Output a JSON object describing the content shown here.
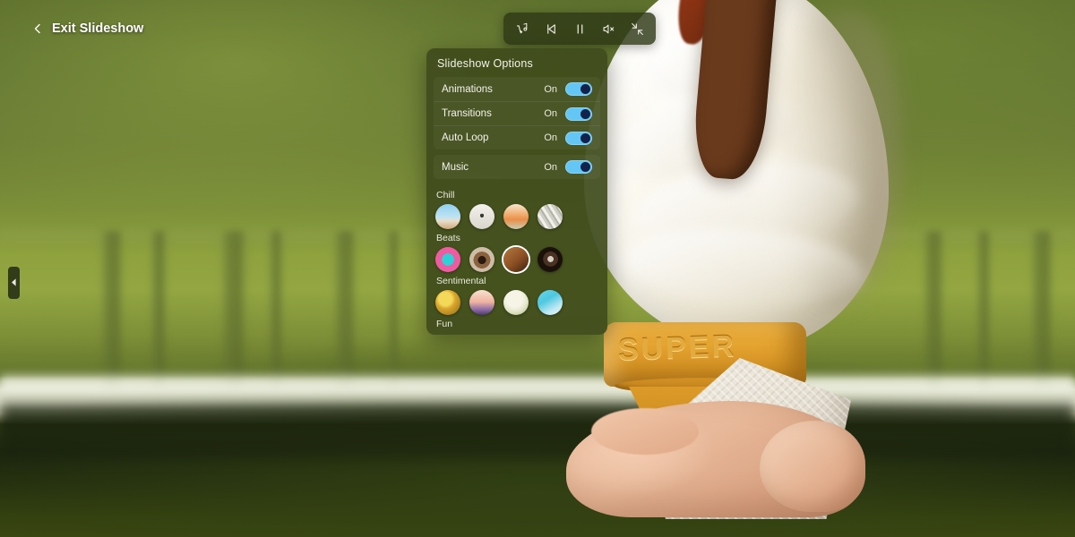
{
  "topbar": {
    "exit_label": "Exit Slideshow",
    "back_icon": "chevron-left-icon"
  },
  "media_toolbar": {
    "buttons": [
      {
        "name": "shuffle-music-button",
        "icon": "shuffle-music-note-icon",
        "title": "Shuffle music"
      },
      {
        "name": "previous-button",
        "icon": "skip-previous-icon",
        "title": "Previous"
      },
      {
        "name": "pause-button",
        "icon": "pause-icon",
        "title": "Pause"
      },
      {
        "name": "mute-button",
        "icon": "speaker-mute-icon",
        "title": "Mute"
      },
      {
        "name": "exit-fullscreen-button",
        "icon": "collapse-arrows-icon",
        "title": "Exit full screen"
      }
    ]
  },
  "left_handle": {
    "icon": "caret-left-icon"
  },
  "panel": {
    "title": "Slideshow Options",
    "toggles": [
      {
        "label": "Animations",
        "state": "On",
        "on": true
      },
      {
        "label": "Transitions",
        "state": "On",
        "on": true
      },
      {
        "label": "Auto Loop",
        "state": "On",
        "on": true
      }
    ],
    "music_toggle": {
      "label": "Music",
      "state": "On",
      "on": true
    },
    "music_categories": [
      {
        "name": "Chill",
        "tracks": [
          {
            "id": "chill-1",
            "selected": false,
            "colors": [
              "#8fd0ef",
              "#bfe3f2",
              "#e8dfcc",
              "#cfa97e"
            ]
          },
          {
            "id": "chill-2",
            "selected": false,
            "colors": [
              "#f4f2ee",
              "#e4e1da",
              "#3a3a34",
              "#d8d5cd"
            ]
          },
          {
            "id": "chill-3",
            "selected": false,
            "colors": [
              "#f7e6cf",
              "#f0a766",
              "#e98f4a",
              "#c9ccb4"
            ]
          },
          {
            "id": "chill-4",
            "selected": false,
            "colors": [
              "#f2f1ec",
              "#d9d8d0",
              "#b3b2a8",
              "#e7e6df"
            ]
          }
        ]
      },
      {
        "name": "Beats",
        "tracks": [
          {
            "id": "beats-1",
            "selected": false,
            "colors": [
              "#f06fae",
              "#ef5ba0",
              "#2ed2d6",
              "#35c9cf"
            ]
          },
          {
            "id": "beats-2",
            "selected": false,
            "colors": [
              "#cdbca6",
              "#6e4a2e",
              "#2b1a10",
              "#8a6240"
            ]
          },
          {
            "id": "beats-3",
            "selected": true,
            "colors": [
              "#b9793f",
              "#8a4f23",
              "#3a2111",
              "#9c6332"
            ]
          },
          {
            "id": "beats-4",
            "selected": false,
            "colors": [
              "#d8cfc2",
              "#4a3222",
              "#1a110a",
              "#6b4a30"
            ]
          }
        ]
      },
      {
        "name": "Sentimental",
        "tracks": [
          {
            "id": "sent-1",
            "selected": false,
            "colors": [
              "#f3d85a",
              "#d9a52c",
              "#8c6a1a",
              "#e8c champion"
            ]
          },
          {
            "id": "sent-2",
            "selected": false,
            "colors": [
              "#f7e2cf",
              "#efb3a0",
              "#8d6ba6",
              "#4a3a6b"
            ]
          },
          {
            "id": "sent-3",
            "selected": false,
            "colors": [
              "#f6f4e6",
              "#e3e6c9",
              "#c3cf9e",
              "#9fae72"
            ]
          },
          {
            "id": "sent-4",
            "selected": false,
            "colors": [
              "#67d7e8",
              "#4fc7e0",
              "#bfe9f2",
              "#e6f6fa"
            ]
          }
        ]
      },
      {
        "name": "Fun",
        "tracks": []
      }
    ]
  },
  "background": {
    "description": "Hand holding a soft-serve ice cream cone with a chocolate flake in front of a blurred white fence and green grass",
    "cone_text": "SUPER"
  }
}
